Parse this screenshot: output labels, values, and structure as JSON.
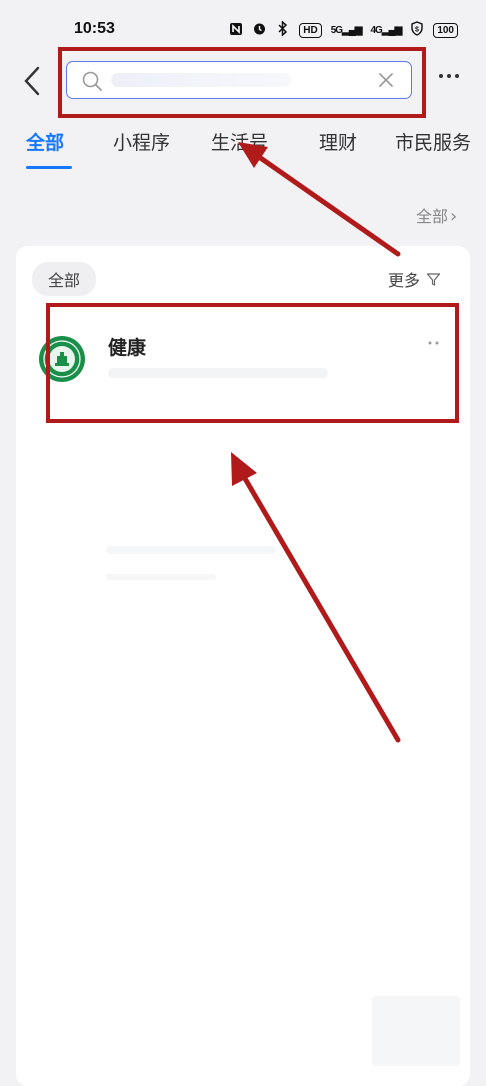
{
  "status_bar": {
    "time": "10:53",
    "icons": [
      "nfc-icon",
      "alarm-icon",
      "bluetooth-icon",
      "hd-icon",
      "signal-5g-icon",
      "signal-4g-icon",
      "vpn-icon"
    ],
    "network_1": "5G",
    "network_2": "4G",
    "hd": "HD",
    "battery": "100"
  },
  "search": {
    "placeholder": "",
    "value": ""
  },
  "tabs": [
    {
      "label": "全部",
      "active": true
    },
    {
      "label": "小程序",
      "active": false
    },
    {
      "label": "生活号",
      "active": false
    },
    {
      "label": "理财",
      "active": false
    },
    {
      "label": "市民服务",
      "active": false
    }
  ],
  "section": {
    "all_link": "全部",
    "chevron": "›"
  },
  "filter": {
    "chip_label": "全部",
    "more_label": "更多"
  },
  "results": [
    {
      "title": "健康",
      "logo": "green-seal-logo"
    }
  ],
  "colors": {
    "accent": "#1677ff",
    "annotation": "#b11a1a",
    "search_border": "#5d7be8",
    "logo_green": "#1a8f4a"
  }
}
